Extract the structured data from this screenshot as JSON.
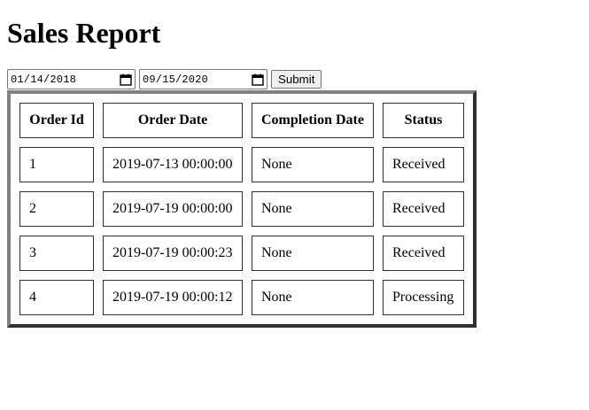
{
  "page": {
    "title": "Sales Report"
  },
  "filters": {
    "start_date": "01/14/2018",
    "end_date": "09/15/2020",
    "submit_label": "Submit"
  },
  "table": {
    "headers": [
      "Order Id",
      "Order Date",
      "Completion Date",
      "Status"
    ],
    "rows": [
      [
        "1",
        "2019-07-13 00:00:00",
        "None",
        "Received"
      ],
      [
        "2",
        "2019-07-19 00:00:00",
        "None",
        "Received"
      ],
      [
        "3",
        "2019-07-19 00:00:23",
        "None",
        "Received"
      ],
      [
        "4",
        "2019-07-19 00:00:12",
        "None",
        "Processing"
      ]
    ]
  },
  "icons": {
    "date_picker": "calendar-icon"
  }
}
